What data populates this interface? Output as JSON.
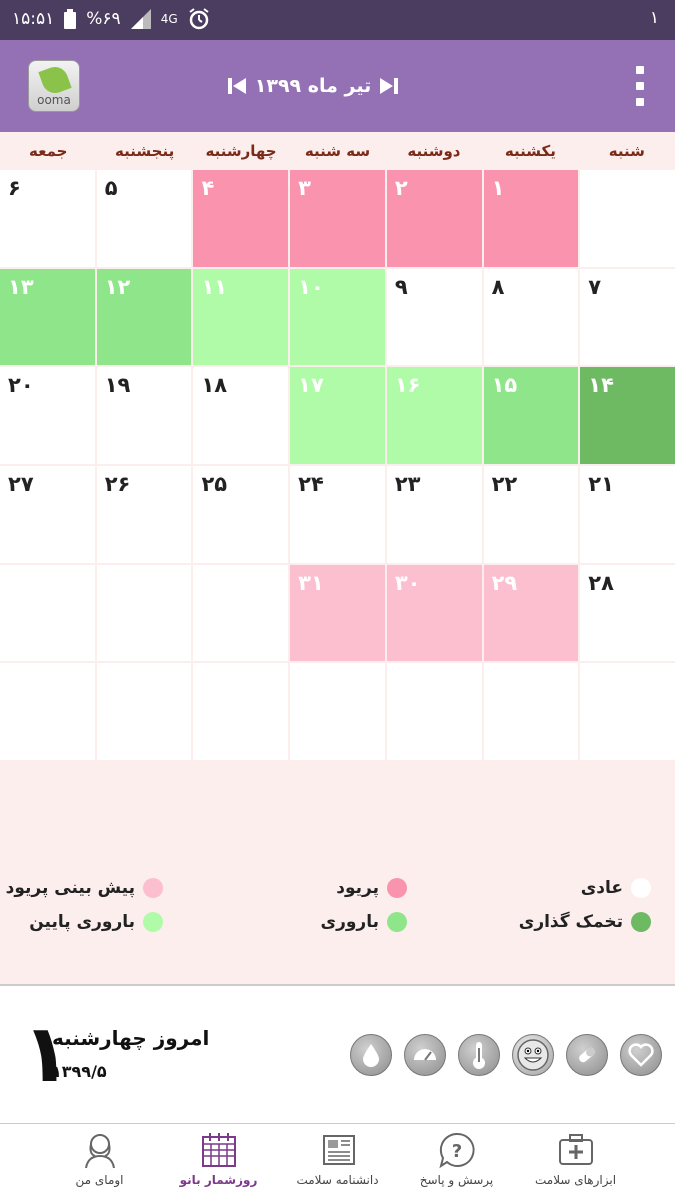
{
  "status_bar": {
    "time": "۱۵:۵۱",
    "battery": "%۶۹",
    "network": "4G",
    "notification_count": "۱"
  },
  "app_bar": {
    "logo_text": "ooma",
    "month_title": "تیر ماه ۱۳۹۹"
  },
  "weekdays": [
    "شنبه",
    "یکشنبه",
    "دوشنبه",
    "سه شنبه",
    "چهارشنبه",
    "پنجشنبه",
    "جمعه"
  ],
  "colors": {
    "normal": "#ffffff",
    "period": "#f993ae",
    "period_prediction": "#fbbfd0",
    "fertility": "#8fe68a",
    "low_fertility": "#b0fba8",
    "ovulation": "#6dba63",
    "primary": "#9470b4"
  },
  "calendar": {
    "cells": [
      {
        "day": "",
        "status": "normal"
      },
      {
        "day": "۱",
        "status": "period"
      },
      {
        "day": "۲",
        "status": "period"
      },
      {
        "day": "۳",
        "status": "period"
      },
      {
        "day": "۴",
        "status": "period"
      },
      {
        "day": "۵",
        "status": "normal"
      },
      {
        "day": "۶",
        "status": "normal"
      },
      {
        "day": "۷",
        "status": "normal"
      },
      {
        "day": "۸",
        "status": "normal"
      },
      {
        "day": "۹",
        "status": "normal"
      },
      {
        "day": "۱۰",
        "status": "low_fertility"
      },
      {
        "day": "۱۱",
        "status": "low_fertility"
      },
      {
        "day": "۱۲",
        "status": "fertility"
      },
      {
        "day": "۱۳",
        "status": "fertility"
      },
      {
        "day": "۱۴",
        "status": "ovulation"
      },
      {
        "day": "۱۵",
        "status": "fertility"
      },
      {
        "day": "۱۶",
        "status": "low_fertility"
      },
      {
        "day": "۱۷",
        "status": "low_fertility"
      },
      {
        "day": "۱۸",
        "status": "normal"
      },
      {
        "day": "۱۹",
        "status": "normal"
      },
      {
        "day": "۲۰",
        "status": "normal"
      },
      {
        "day": "۲۱",
        "status": "normal"
      },
      {
        "day": "۲۲",
        "status": "normal"
      },
      {
        "day": "۲۳",
        "status": "normal"
      },
      {
        "day": "۲۴",
        "status": "normal"
      },
      {
        "day": "۲۵",
        "status": "normal"
      },
      {
        "day": "۲۶",
        "status": "normal"
      },
      {
        "day": "۲۷",
        "status": "normal"
      },
      {
        "day": "۲۸",
        "status": "normal"
      },
      {
        "day": "۲۹",
        "status": "period_prediction"
      },
      {
        "day": "۳۰",
        "status": "period_prediction"
      },
      {
        "day": "۳۱",
        "status": "period_prediction"
      },
      {
        "day": "",
        "status": "normal"
      },
      {
        "day": "",
        "status": "normal"
      },
      {
        "day": "",
        "status": "normal"
      },
      {
        "day": "",
        "status": "normal"
      },
      {
        "day": "",
        "status": "normal"
      },
      {
        "day": "",
        "status": "normal"
      },
      {
        "day": "",
        "status": "normal"
      },
      {
        "day": "",
        "status": "normal"
      },
      {
        "day": "",
        "status": "normal"
      },
      {
        "day": "",
        "status": "normal"
      }
    ]
  },
  "legend": {
    "normal": "عادی",
    "period": "پریود",
    "period_prediction": "پیش بینی پریود",
    "ovulation": "تخمک گذاری",
    "fertility": "باروری",
    "low_fertility": "باروری پایین"
  },
  "today": {
    "label": "امروز چهارشنبه",
    "date": "۱۳۹۹/۵",
    "day": "۱"
  },
  "bottom_nav": {
    "items": [
      {
        "label": "ابزارهای سلامت",
        "icon": "health-kit-icon"
      },
      {
        "label": "پرسش و پاسخ",
        "icon": "question-icon"
      },
      {
        "label": "دانشنامه سلامت",
        "icon": "newspaper-icon"
      },
      {
        "label": "روزشمار بانو",
        "icon": "calendar-icon",
        "active": true
      },
      {
        "label": "اومای من",
        "icon": "woman-profile-icon"
      }
    ]
  }
}
